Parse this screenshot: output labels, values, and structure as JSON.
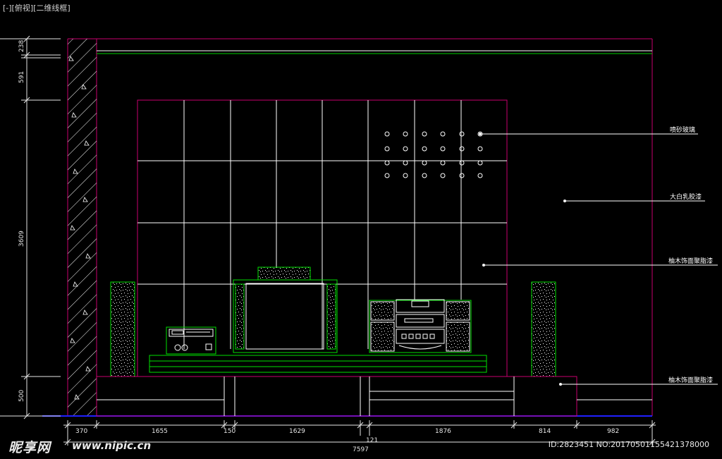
{
  "viewport": {
    "label": "[-][俯视][二维线框]"
  },
  "callouts": {
    "frosted_glass": "喷砂玻璃",
    "white_latex_paint": "大白乳胶漆",
    "teak_veneer_varnish_1": "柚木饰面聚脂漆",
    "teak_veneer_varnish_2": "柚木饰面聚脂漆"
  },
  "dimensions": {
    "horizontal": [
      "370",
      "1655",
      "150",
      "1629",
      "1876",
      "814",
      "982"
    ],
    "horizontal_extra": "121",
    "total": "7597",
    "vertical": [
      "238",
      "591",
      "3609",
      "500"
    ]
  },
  "watermark": {
    "logo": "昵享网",
    "url": "www.nipic.cn",
    "id": "ID:2823451 NO:20170501155421378000"
  },
  "colors": {
    "background": "#000000",
    "outline": "#c8006e",
    "line": "#ffffff",
    "equipment": "#00e000",
    "floor": "#2020ff",
    "dimension": "#e6e6e6"
  }
}
